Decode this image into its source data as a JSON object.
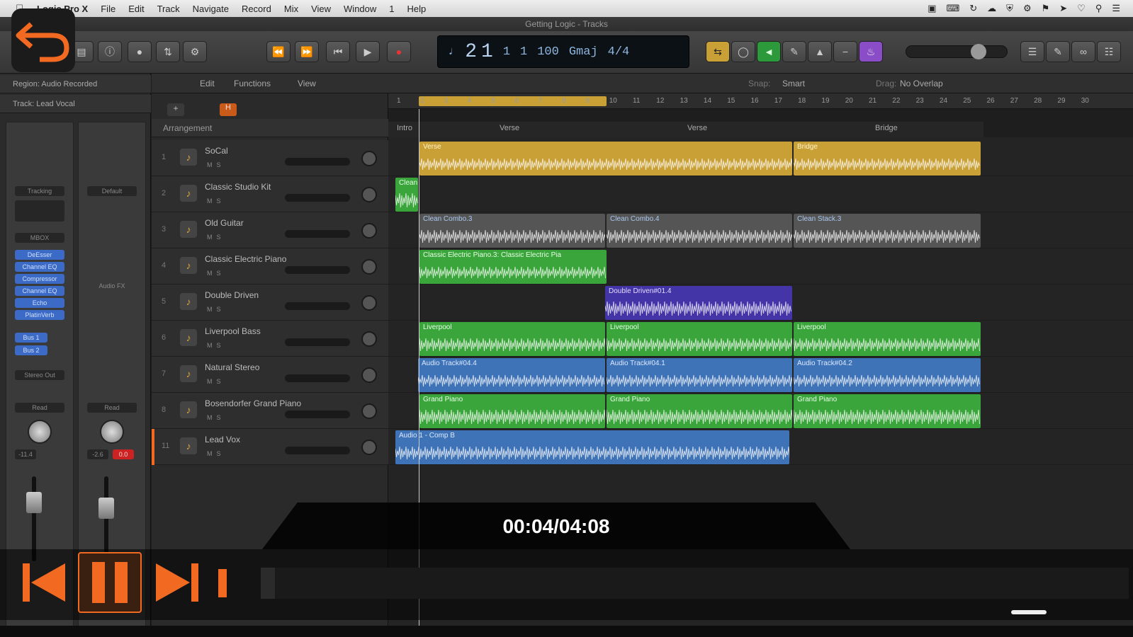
{
  "menubar": {
    "apple": "",
    "app": "Logic Pro X",
    "items": [
      "File",
      "Edit",
      "Track",
      "Navigate",
      "Record",
      "Mix",
      "View",
      "Window",
      "1",
      "Help"
    ],
    "status_icons": [
      "camera-icon",
      "keyboard-icon",
      "sync-icon",
      "cloud-icon",
      "shield-icon",
      "gear-icon",
      "tool-icon",
      "arrow-icon",
      "heart-icon",
      "search-icon",
      "list-icon"
    ]
  },
  "window": {
    "title": "Getting Logic - Tracks"
  },
  "lcd": {
    "bar": "2",
    "beat": "1",
    "div": "1",
    "tick": "1",
    "tempo": "100",
    "key": "Gmaj",
    "sig": "4/4"
  },
  "inspector": {
    "region_header": "Region: Audio Recorded",
    "track_header": "Track: Lead Vocal",
    "left_setting": "Tracking",
    "right_setting": "Default",
    "plugins": [
      "DeEsser",
      "Channel EQ",
      "Compressor",
      "Channel EQ",
      "Echo",
      "PlatinVerb"
    ],
    "sends": [
      "Bus 1",
      "Bus 2"
    ],
    "output": "Stereo Out",
    "automation_left": "Read",
    "automation_right": "Read",
    "left_value": "-11.4",
    "right_value": "-2.6",
    "right_peak": "0.0",
    "left_input": "MBOX",
    "right_fx": "Audio FX"
  },
  "localbar": {
    "edit": "Edit",
    "functions": "Functions",
    "view": "View",
    "snap_label": "Snap:",
    "snap_value": "Smart",
    "drag_label": "Drag:",
    "drag_value": "No Overlap"
  },
  "arrangement_label": "Arrangement",
  "ruler": {
    "bars": [
      "1",
      "2",
      "3",
      "4",
      "5",
      "6",
      "7",
      "8",
      "9",
      "10",
      "11",
      "12",
      "13",
      "14",
      "15",
      "16",
      "17",
      "18",
      "19",
      "20",
      "21",
      "22",
      "23",
      "24",
      "25",
      "26",
      "27",
      "28",
      "29",
      "30"
    ],
    "markers": [
      "Intro",
      "Verse",
      "Verse",
      "Bridge"
    ]
  },
  "tracks": [
    {
      "num": "1",
      "name": "SoCal",
      "icon": "drum-icon"
    },
    {
      "num": "2",
      "name": "Classic Studio Kit",
      "icon": "drumkit-icon"
    },
    {
      "num": "3",
      "name": "Old Guitar",
      "icon": "amp-icon"
    },
    {
      "num": "4",
      "name": "Classic Electric Piano",
      "icon": "keys-icon"
    },
    {
      "num": "5",
      "name": "Double Driven",
      "icon": "amp-icon"
    },
    {
      "num": "6",
      "name": "Liverpool Bass",
      "icon": "bass-icon"
    },
    {
      "num": "7",
      "name": "Natural Stereo",
      "icon": "guitar-icon"
    },
    {
      "num": "8",
      "name": "Bosendorfer Grand Piano",
      "icon": "piano-icon"
    },
    {
      "num": "11",
      "name": "Lead Vox",
      "icon": "mic-icon"
    }
  ],
  "regions": {
    "socal": [
      "Verse",
      "Bridge"
    ],
    "classic_kit": [
      "Clean"
    ],
    "old_guitar": [
      "Clean Combo.3",
      "Clean Combo.4",
      "Clean Stack.3"
    ],
    "electric_piano": [
      "Classic Electric Piano.3: Classic Electric Pia"
    ],
    "double_driven": [
      "Double Driven#01.4"
    ],
    "liverpool": [
      "Liverpool",
      "Liverpool",
      "Liverpool"
    ],
    "natural": [
      "Audio Track#04.4",
      "Audio Track#04.1",
      "Audio Track#04.2"
    ],
    "grand": [
      "Grand Piano",
      "Grand Piano",
      "Grand Piano"
    ],
    "lead_vox": [
      "Audio 1 - Comp B"
    ]
  },
  "player": {
    "timecode": "00:04/04:08",
    "progress": 0.016,
    "back_label": "back"
  },
  "colors": {
    "accent_orange": "#f26a21",
    "yellow_region": "#c9a035",
    "green_region": "#3aa53a",
    "blue_region": "#3f73b7",
    "purple_region": "#4335a8",
    "gray_region": "#555555"
  }
}
